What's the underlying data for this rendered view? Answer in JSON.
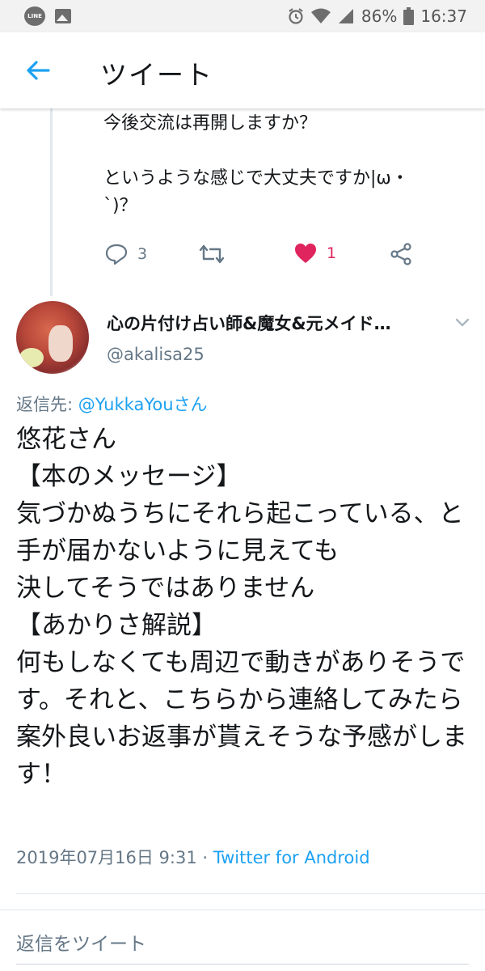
{
  "status_bar": {
    "battery": "86%",
    "time": "16:37",
    "line_icon_label": "LINE"
  },
  "header": {
    "title": "ツイート"
  },
  "parent_tweet": {
    "text": "現在疎遠になってるけどさん。\n今後交流は再開しますか？\n\nというような感じで大丈夫ですか|ω・\n`)？",
    "reply_count": "3",
    "like_count": "1"
  },
  "reply_tweet": {
    "display_name": "心の片付け占い師&魔女&元メイド…",
    "username": "@akalisa25",
    "reply_to_prefix": "返信先: ",
    "reply_to_mention": "@YukkaYouさん",
    "body": "悠花さん\n【本のメッセージ】\n気づかぬうちにそれら起こっている、と\n手が届かないように見えても\n決してそうではありません\n【あかりさ解説】\n何もしなくても周辺で動きがありそうです。それと、こちらから連絡してみたら案外良いお返事が貰えそうな予感がします！",
    "timestamp": "2019年07月16日 9:31 · ",
    "source": "Twitter for Android"
  },
  "composer": {
    "placeholder": "返信をツイート"
  },
  "colors": {
    "accent": "#1da1f2",
    "like": "#e0245e",
    "secondary_text": "#657786"
  }
}
